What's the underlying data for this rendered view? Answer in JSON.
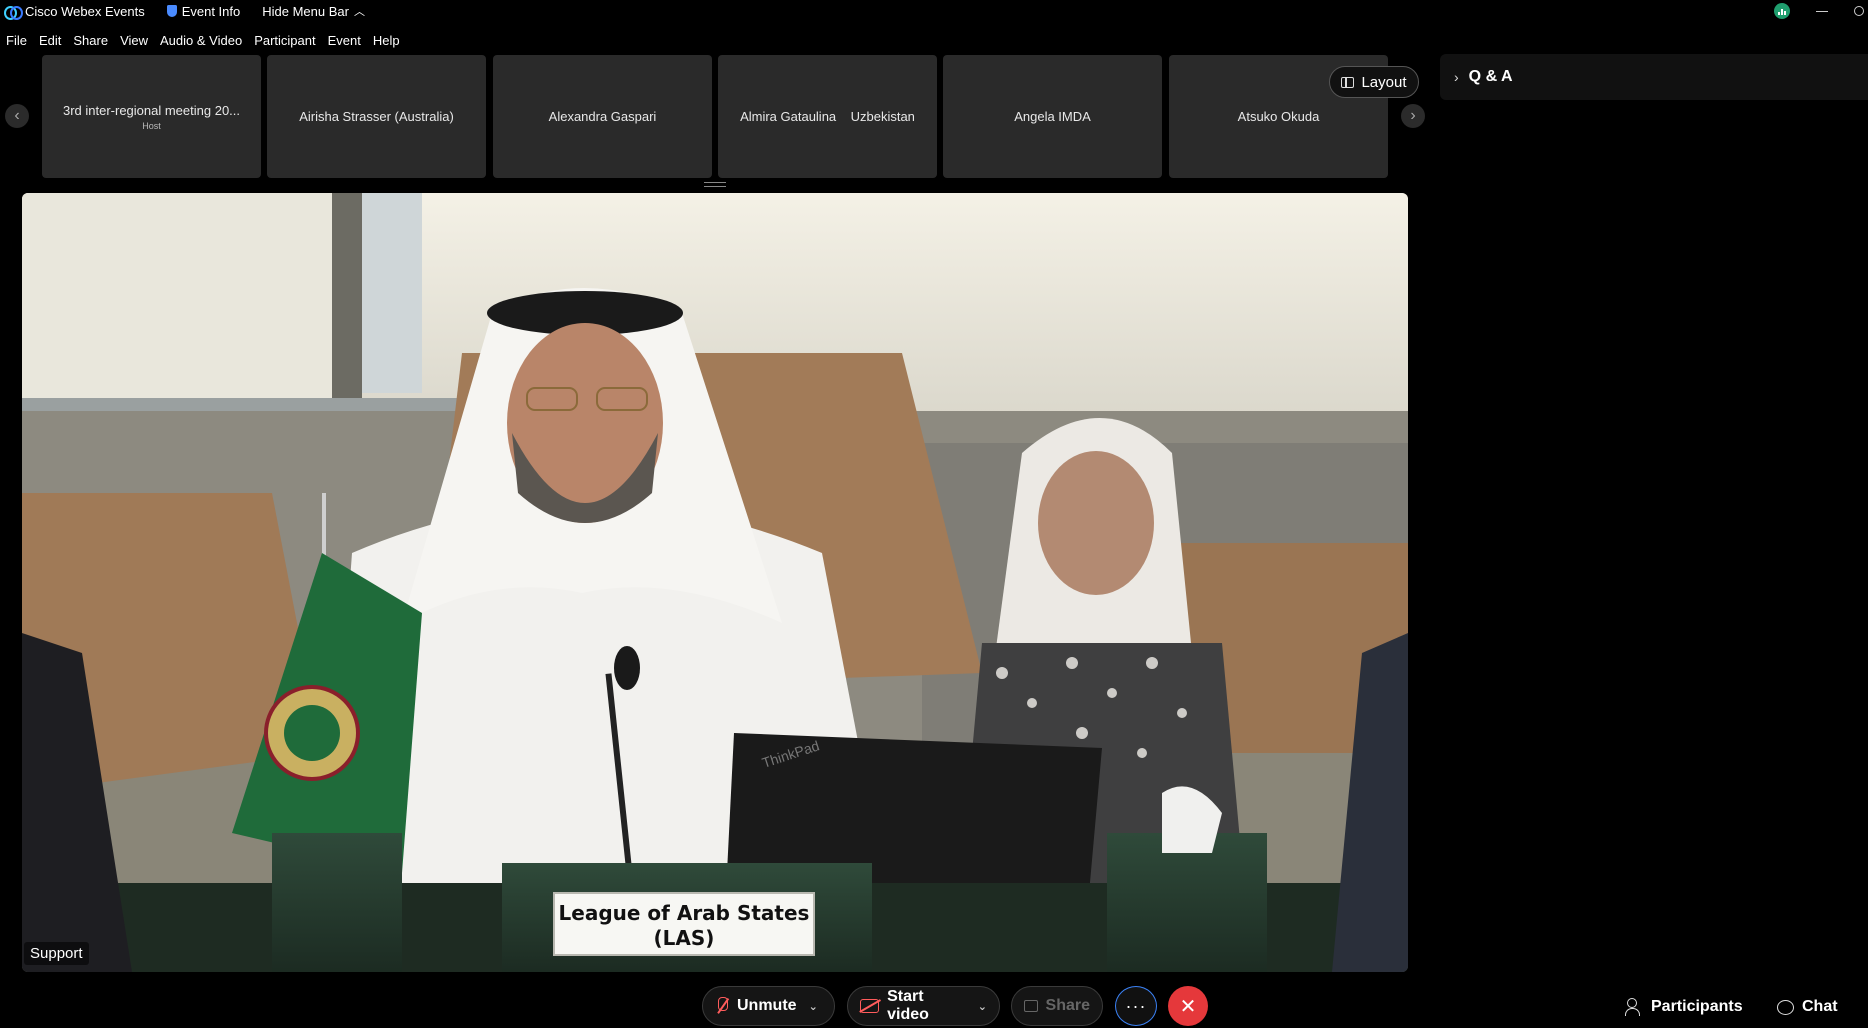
{
  "titlebar": {
    "app_name": "Cisco Webex Events",
    "event_info": "Event Info",
    "hide_menu": "Hide Menu Bar"
  },
  "menu": [
    "File",
    "Edit",
    "Share",
    "View",
    "Audio & Video",
    "Participant",
    "Event",
    "Help"
  ],
  "thumbnails": [
    {
      "name": "3rd inter-regional meeting 20...",
      "role": "Host"
    },
    {
      "name": "Airisha Strasser (Australia)",
      "role": ""
    },
    {
      "name": "Alexandra Gaspari",
      "role": ""
    },
    {
      "name": "Almira Gataulina    Uzbekistan",
      "role": ""
    },
    {
      "name": "Angela IMDA",
      "role": ""
    },
    {
      "name": "Atsuko Okuda",
      "role": ""
    }
  ],
  "layout_button": "Layout",
  "qa_panel": {
    "title": "Q & A"
  },
  "video": {
    "speaker_label": "Support",
    "nameplate_line1": "League of Arab States",
    "nameplate_line2": "(LAS)",
    "laptop_brand": "ThinkPad"
  },
  "controls": {
    "unmute": "Unmute",
    "start_video": "Start video",
    "share": "Share",
    "more": "···",
    "end": "✕",
    "participants": "Participants",
    "chat": "Chat"
  },
  "colors": {
    "background": "#000000",
    "thumbnail_bg": "#2a2a2a",
    "end_button": "#e5383b",
    "muted_icon": "#ff5c5c",
    "focus_ring": "#3b82f6"
  }
}
